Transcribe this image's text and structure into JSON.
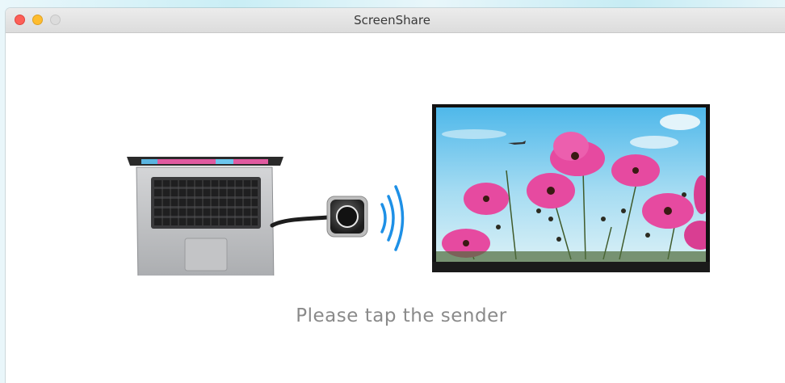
{
  "window": {
    "title": "ScreenShare"
  },
  "status": {
    "message": "Please tap the sender"
  },
  "colors": {
    "close": "#fd5f57",
    "minimize": "#febc2e",
    "maximize": "#dcdcdc",
    "wave": "#1e90e6",
    "flower": "#e64aa0",
    "sky": "#6cc6ee"
  },
  "icons": [
    "close-icon",
    "minimize-icon",
    "maximize-icon",
    "laptop-icon",
    "sender-dongle-icon",
    "wireless-signal-icon",
    "display-screen-icon"
  ]
}
